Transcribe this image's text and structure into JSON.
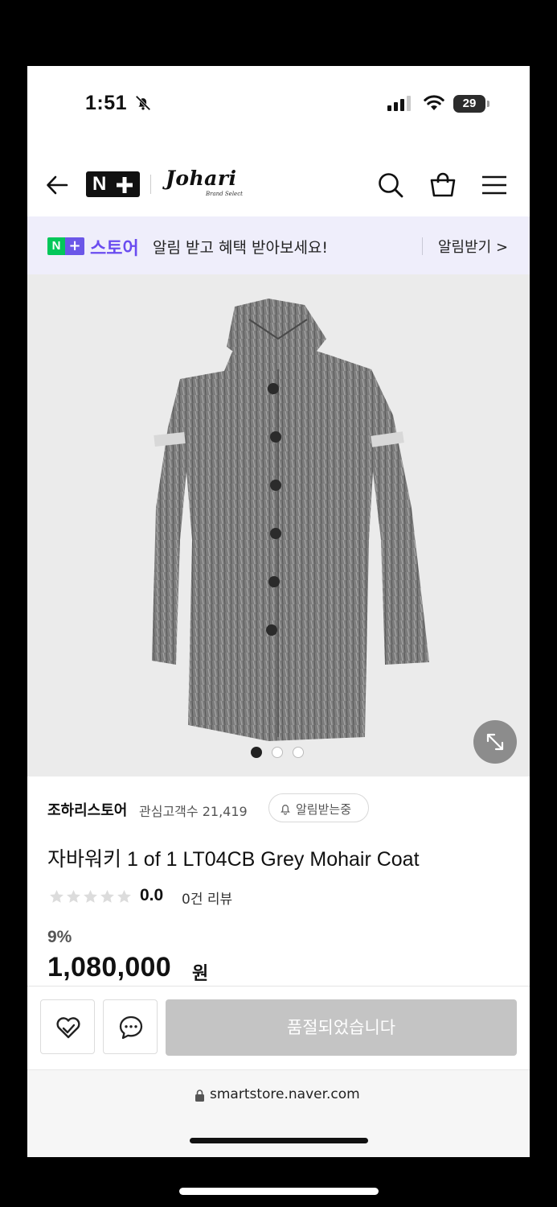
{
  "status": {
    "time": "1:51",
    "battery": "29"
  },
  "header": {
    "nplus_label": "N",
    "logo": "Johari",
    "logo_sub": "Brand Select"
  },
  "banner": {
    "store_badge_n": "N",
    "store_label": "스토어",
    "message": "알림 받고 혜택 받아보세요!",
    "action": "알림받기 >"
  },
  "gallery": {
    "total": 3,
    "active_index": 0
  },
  "product": {
    "store_name": "조하리스토어",
    "fans_label": "관심고객수",
    "fans_count": "21,419",
    "notify_label": "알림받는중",
    "title": "자바워키 1 of 1 LT04CB Grey Mohair Coat",
    "rating": "0.0",
    "review_count": "0건 리뷰",
    "discount": "9%",
    "price": "1,080,000",
    "currency": "원"
  },
  "actions": {
    "soldout_label": "품절되었습니다"
  },
  "browser": {
    "url": "smartstore.naver.com"
  },
  "colors": {
    "brand_purple": "#6a4cf0",
    "naver_green": "#03c75a",
    "banner_bg": "#efeefb",
    "soldout_bg": "#c4c4c4"
  }
}
